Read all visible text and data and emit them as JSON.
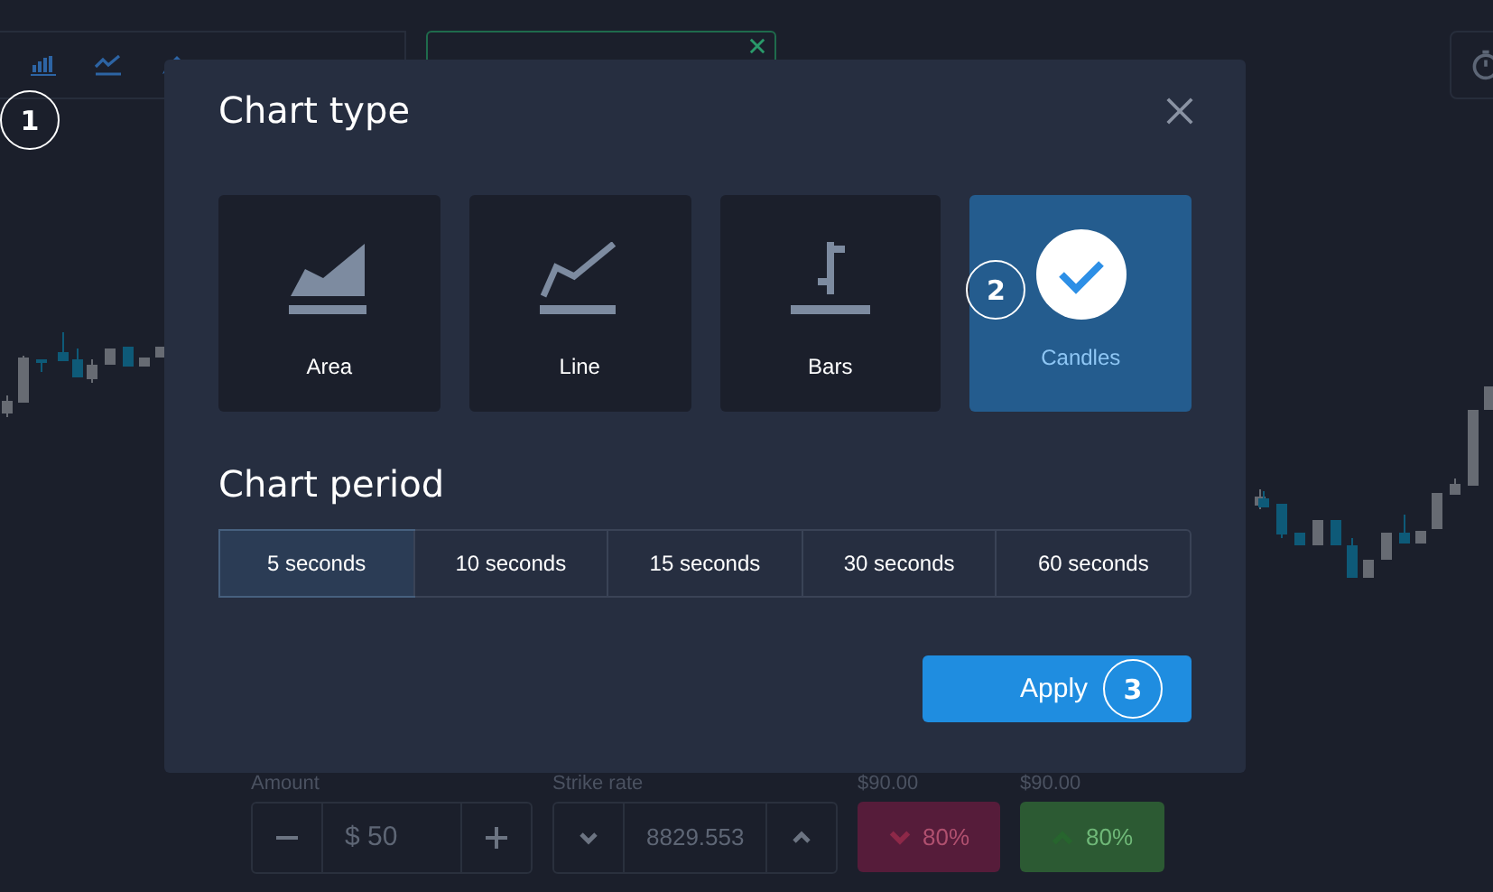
{
  "callouts": [
    {
      "label": "1"
    },
    {
      "label": "2"
    },
    {
      "label": "3"
    }
  ],
  "dialog": {
    "title": "Chart type",
    "chart_types": [
      {
        "kind": "area",
        "label": "Area",
        "selected": false
      },
      {
        "kind": "line",
        "label": "Line",
        "selected": false
      },
      {
        "kind": "bars",
        "label": "Bars",
        "selected": false
      },
      {
        "kind": "candles",
        "label": "Candles",
        "selected": true
      }
    ],
    "period_title": "Chart period",
    "periods": [
      {
        "label": "5 seconds",
        "selected": true
      },
      {
        "label": "10 seconds",
        "selected": false
      },
      {
        "label": "15 seconds",
        "selected": false
      },
      {
        "label": "30 seconds",
        "selected": false
      },
      {
        "label": "60 seconds",
        "selected": false
      }
    ],
    "apply_button": "Apply"
  },
  "trade_panel": {
    "amount_label": "Amount",
    "amount": "$ 50",
    "strike_label": "Strike rate",
    "strike": "8829.553",
    "buttons": [
      {
        "kind": "down",
        "price": "$90.00",
        "payout": "80%"
      },
      {
        "kind": "up",
        "price": "$90.00",
        "payout": "80%"
      }
    ]
  }
}
